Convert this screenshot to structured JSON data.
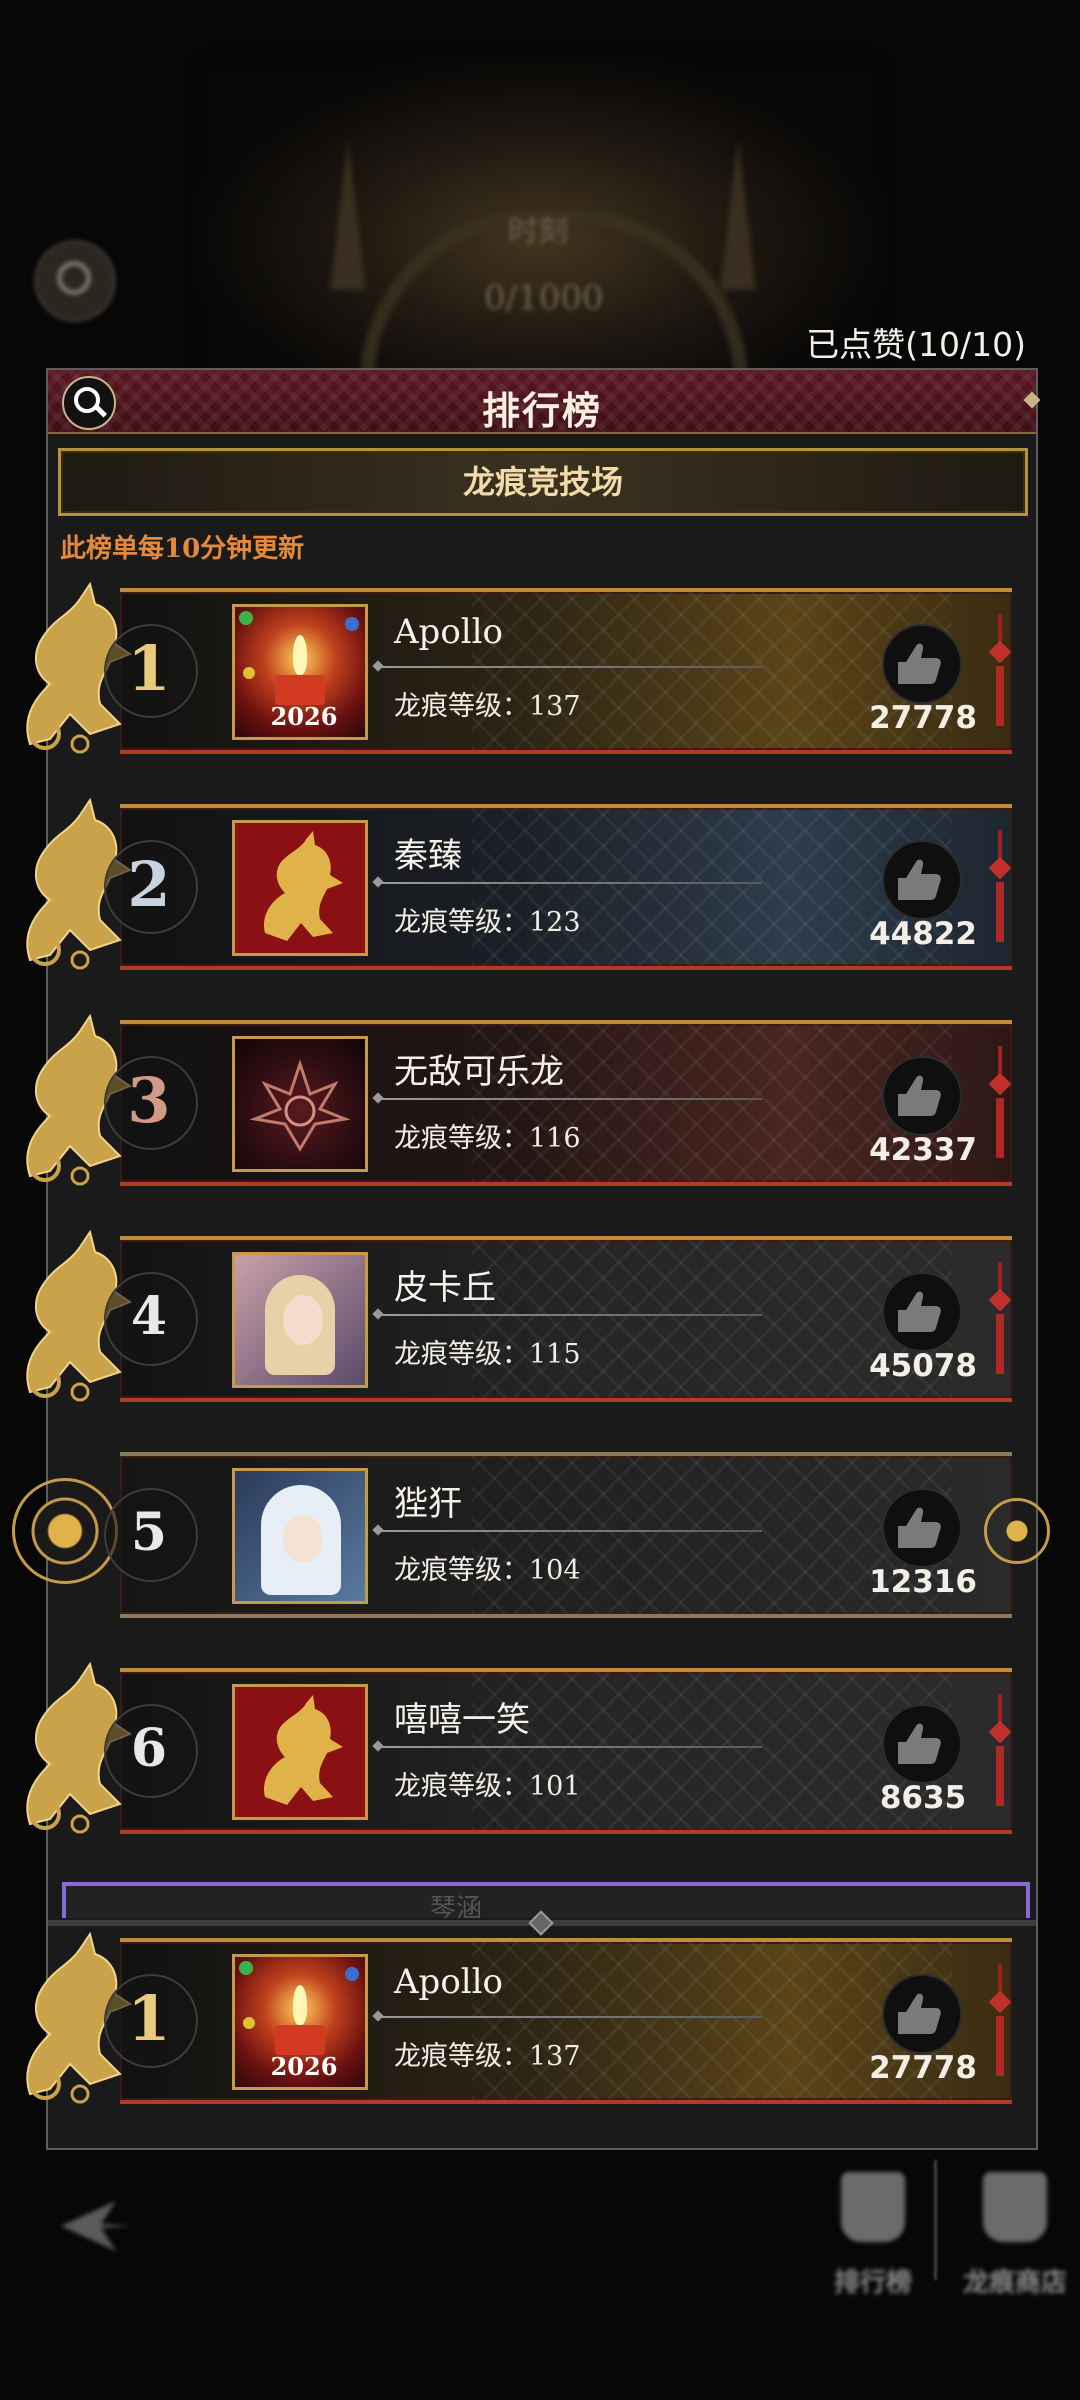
{
  "background": {
    "top_label": "时刻",
    "progress_text": "0/1000"
  },
  "likes_counter": "已点赞(10/10)",
  "panel": {
    "title": "排行榜",
    "category": "龙痕竞技场",
    "update_note": "此榜单每10分钟更新"
  },
  "rows": [
    {
      "rank": "1",
      "name": "Apollo",
      "level": "龙痕等级：137",
      "likes": "27778",
      "avatar_icon": "candle-2026-avatar",
      "style": "gold"
    },
    {
      "rank": "2",
      "name": "秦臻",
      "level": "龙痕等级：123",
      "likes": "44822",
      "avatar_icon": "golden-horse-avatar",
      "style": "silver"
    },
    {
      "rank": "3",
      "name": "无敌可乐龙",
      "level": "龙痕等级：116",
      "likes": "42337",
      "avatar_icon": "dark-lotus-avatar",
      "style": "bronze"
    },
    {
      "rank": "4",
      "name": "皮卡丘",
      "level": "龙痕等级：115",
      "likes": "45078",
      "avatar_icon": "blonde-girl-avatar",
      "style": "normal"
    },
    {
      "rank": "5",
      "name": "狴犴",
      "level": "龙痕等级：104",
      "likes": "12316",
      "avatar_icon": "silver-hair-avatar",
      "style": "special"
    },
    {
      "rank": "6",
      "name": "嘻嘻一笑",
      "level": "龙痕等级：101",
      "likes": "8635",
      "avatar_icon": "golden-horse-avatar",
      "style": "normal"
    }
  ],
  "partial_row_name": "琴涵",
  "my_rank": {
    "rank": "1",
    "name": "Apollo",
    "level": "龙痕等级：137",
    "likes": "27778"
  },
  "bottom_nav": {
    "leaderboard_label": "排行榜",
    "shop_label": "龙痕商店"
  },
  "colors": {
    "accent_gold": "#c59a4b",
    "update_note": "#e58a3c",
    "header_red": "#5a1620"
  }
}
